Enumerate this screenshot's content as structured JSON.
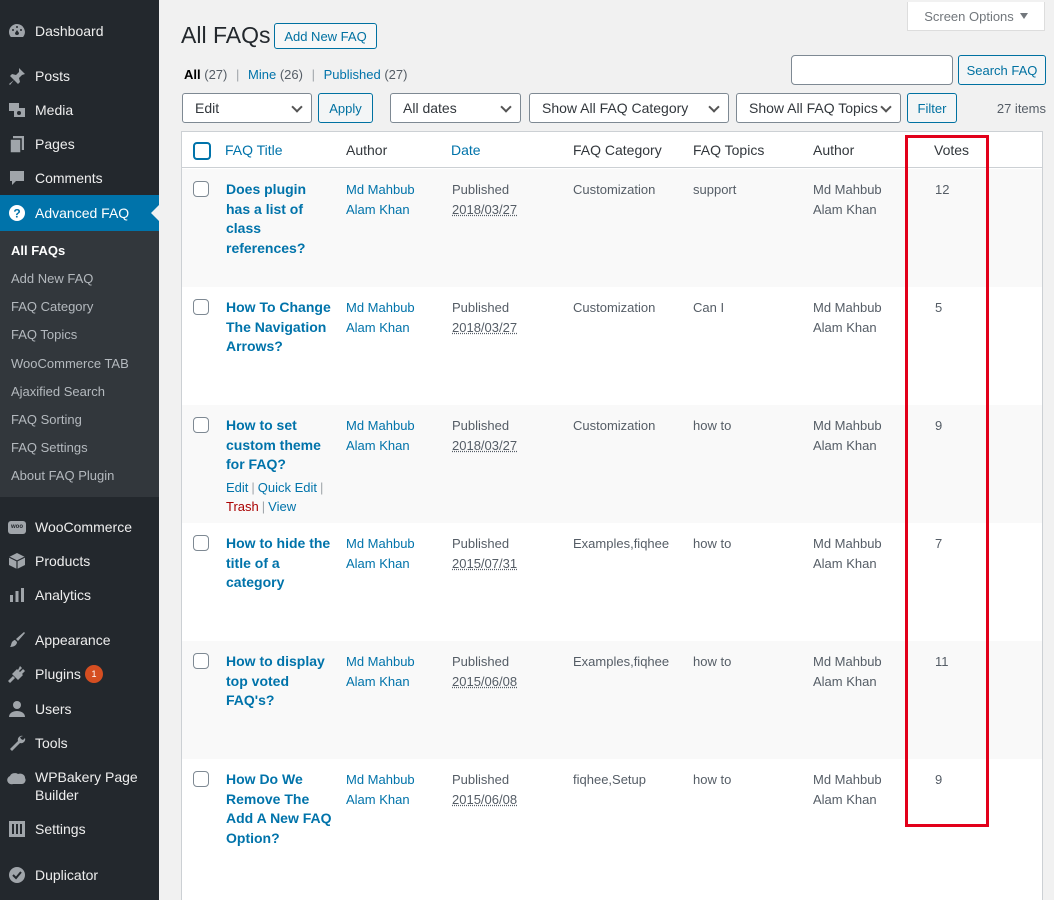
{
  "sidebar": {
    "menu": [
      {
        "label": "Dashboard",
        "icon": "dashboard-icon"
      },
      {
        "label": "Posts",
        "icon": "pin-icon"
      },
      {
        "label": "Media",
        "icon": "media-icon"
      },
      {
        "label": "Pages",
        "icon": "pages-icon"
      },
      {
        "label": "Comments",
        "icon": "comments-icon"
      },
      {
        "label": "Advanced FAQ",
        "icon": "question-icon"
      },
      {
        "label": "WooCommerce",
        "icon": "woocommerce-icon"
      },
      {
        "label": "Products",
        "icon": "box-icon"
      },
      {
        "label": "Analytics",
        "icon": "bar-chart-icon"
      },
      {
        "label": "Appearance",
        "icon": "paintbrush-icon"
      },
      {
        "label": "Plugins",
        "icon": "plug-icon",
        "badge": "1"
      },
      {
        "label": "Users",
        "icon": "user-icon"
      },
      {
        "label": "Tools",
        "icon": "wrench-icon"
      },
      {
        "label": "WPBakery Page",
        "label2": "Builder",
        "icon": "wpbakery-icon"
      },
      {
        "label": "Settings",
        "icon": "sliders-icon"
      },
      {
        "label": "Duplicator",
        "icon": "duplicator-icon"
      }
    ],
    "submenu": [
      "All FAQs",
      "Add New FAQ",
      "FAQ Category",
      "FAQ Topics",
      "WooCommerce TAB",
      "Ajaxified Search",
      "FAQ Sorting",
      "FAQ Settings",
      "About FAQ Plugin"
    ],
    "woo_icon_text": "woo"
  },
  "header": {
    "title": "All FAQs",
    "add_new": "Add New FAQ",
    "screen_options": "Screen Options"
  },
  "views": {
    "all": "All",
    "all_count": "(27)",
    "mine": "Mine",
    "mine_count": "(26)",
    "published": "Published",
    "published_count": "(27)",
    "separator": "|"
  },
  "search": {
    "value": "",
    "button": "Search FAQ"
  },
  "filters": {
    "bulk_action": "Edit",
    "apply": "Apply",
    "dates": "All dates",
    "category": "Show All FAQ Category",
    "topics": "Show All FAQ Topics",
    "filter": "Filter",
    "items": "27 items"
  },
  "table": {
    "columns": {
      "title": "FAQ Title",
      "author": "Author",
      "date": "Date",
      "category": "FAQ Category",
      "topics": "FAQ Topics",
      "author2": "Author",
      "votes": "Votes"
    },
    "rows": [
      {
        "title": "Does plugin has a list of class references?",
        "author": "Md Mahbub Alam Khan",
        "status": "Published",
        "date": "2018/03/27",
        "category": "Customization",
        "topics": "support",
        "author2": "Md Mahbub Alam Khan",
        "votes": "12"
      },
      {
        "title": "How To Change The Navigation Arrows?",
        "author": "Md Mahbub Alam Khan",
        "status": "Published",
        "date": "2018/03/27",
        "category": "Customization",
        "topics": "Can I",
        "author2": "Md Mahbub Alam Khan",
        "votes": "5"
      },
      {
        "title": "How to set custom theme for FAQ?",
        "author": "Md Mahbub Alam Khan",
        "status": "Published",
        "date": "2018/03/27",
        "category": "Customization",
        "topics": "how to",
        "author2": "Md Mahbub Alam Khan",
        "votes": "9",
        "actions": {
          "edit": "Edit",
          "quick_edit": "Quick Edit",
          "trash": "Trash",
          "view": "View"
        }
      },
      {
        "title": "How to hide the title of a category",
        "author": "Md Mahbub Alam Khan",
        "status": "Published",
        "date": "2015/07/31",
        "category": "Examples,fiqhee",
        "topics": "how to",
        "author2": "Md Mahbub Alam Khan",
        "votes": "7"
      },
      {
        "title": "How to display top voted FAQ's?",
        "author": "Md Mahbub Alam Khan",
        "status": "Published",
        "date": "2015/06/08",
        "category": "Examples,fiqhee",
        "topics": "how to",
        "author2": "Md Mahbub Alam Khan",
        "votes": "11"
      },
      {
        "title": "How Do We Remove The Add A New FAQ Option?",
        "author": "Md Mahbub Alam Khan",
        "status": "Published",
        "date": "2015/06/08",
        "category": "fiqhee,Setup",
        "topics": "how to",
        "author2": "Md Mahbub Alam Khan",
        "votes": "9"
      }
    ]
  },
  "colors": {
    "admin_bar": "#23282d",
    "accent": "#0073aa",
    "highlight": "#e2001a",
    "badge": "#d54e21"
  }
}
